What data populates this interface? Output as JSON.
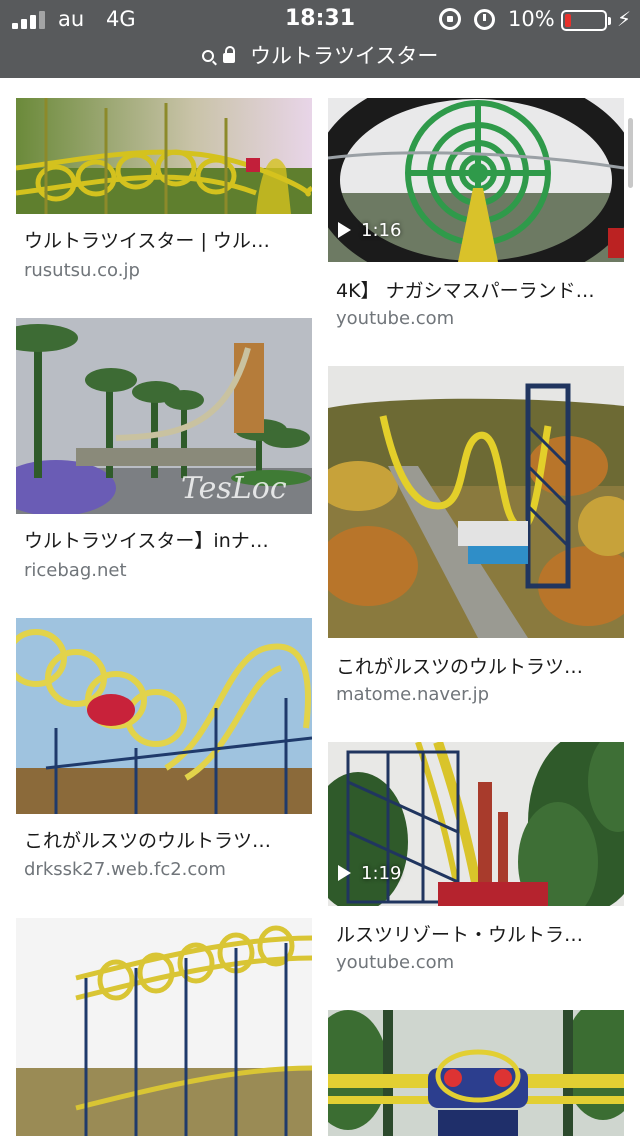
{
  "status": {
    "carrier": "au",
    "network": "4G",
    "time": "18:31",
    "battery_percent": "10%",
    "icons": [
      "signal-icon",
      "rotation-lock-icon",
      "alarm-icon",
      "battery-icon",
      "charging-bolt-icon"
    ]
  },
  "url_bar": {
    "query": "ウルトラツイスター"
  },
  "results": [
    {
      "title": "ウルトラツイスター | ウル…",
      "domain": "rusutsu.co.jp"
    },
    {
      "title": "4K】 ナガシマスパーランド…",
      "domain": "youtube.com",
      "duration": "1:16"
    },
    {
      "title": "ウルトラツイスター】inナ…",
      "domain": "ricebag.net",
      "watermark": "TesLoc"
    },
    {
      "title": "これがルスツのウルトラツ…",
      "domain": "matome.naver.jp"
    },
    {
      "title": "これがルスツのウルトラツ…",
      "domain": "drkssk27.web.fc2.com"
    },
    {
      "title": "ルスツリゾート・ウルトラ…",
      "domain": "youtube.com",
      "duration": "1:19"
    },
    {
      "title": "",
      "domain": ""
    },
    {
      "title": "",
      "domain": ""
    }
  ]
}
